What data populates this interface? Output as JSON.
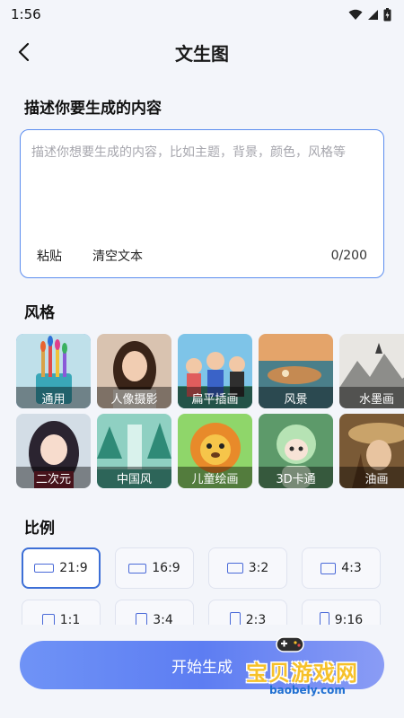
{
  "status_bar": {
    "time": "1:56"
  },
  "header": {
    "title": "文生图"
  },
  "prompt": {
    "section_title": "描述你要生成的内容",
    "placeholder": "描述你想要生成的内容，比如主题，背景，颜色，风格等",
    "value": "",
    "paste_label": "粘贴",
    "clear_label": "清空文本",
    "counter": "0/200"
  },
  "styles": {
    "section_title": "风格",
    "items": [
      {
        "label": "通用",
        "icon": "brushes-thumb",
        "selected": true
      },
      {
        "label": "人像摄影",
        "icon": "portrait-thumb"
      },
      {
        "label": "扁平插画",
        "icon": "flat-illustration-thumb"
      },
      {
        "label": "风景",
        "icon": "landscape-thumb"
      },
      {
        "label": "水墨画",
        "icon": "ink-painting-thumb"
      },
      {
        "label": "二次元",
        "icon": "anime-thumb"
      },
      {
        "label": "中国风",
        "icon": "chinese-style-thumb"
      },
      {
        "label": "儿童绘画",
        "icon": "kids-drawing-thumb"
      },
      {
        "label": "3D卡通",
        "icon": "3d-cartoon-thumb"
      },
      {
        "label": "油画",
        "icon": "oil-painting-thumb"
      }
    ]
  },
  "ratios": {
    "section_title": "比例",
    "items": [
      {
        "label": "21:9",
        "selected": true
      },
      {
        "label": "16:9"
      },
      {
        "label": "3:2"
      },
      {
        "label": "4:3"
      },
      {
        "label": "1:1"
      },
      {
        "label": "3:4"
      },
      {
        "label": "2:3"
      },
      {
        "label": "9:16"
      }
    ]
  },
  "actions": {
    "start_label": "开始生成"
  },
  "watermark": {
    "text": "宝贝游戏网",
    "url": "baobely.com"
  },
  "colors": {
    "accent": "#5b8def",
    "button_start": "#6f93f6",
    "button_end": "#8a9cf5"
  }
}
